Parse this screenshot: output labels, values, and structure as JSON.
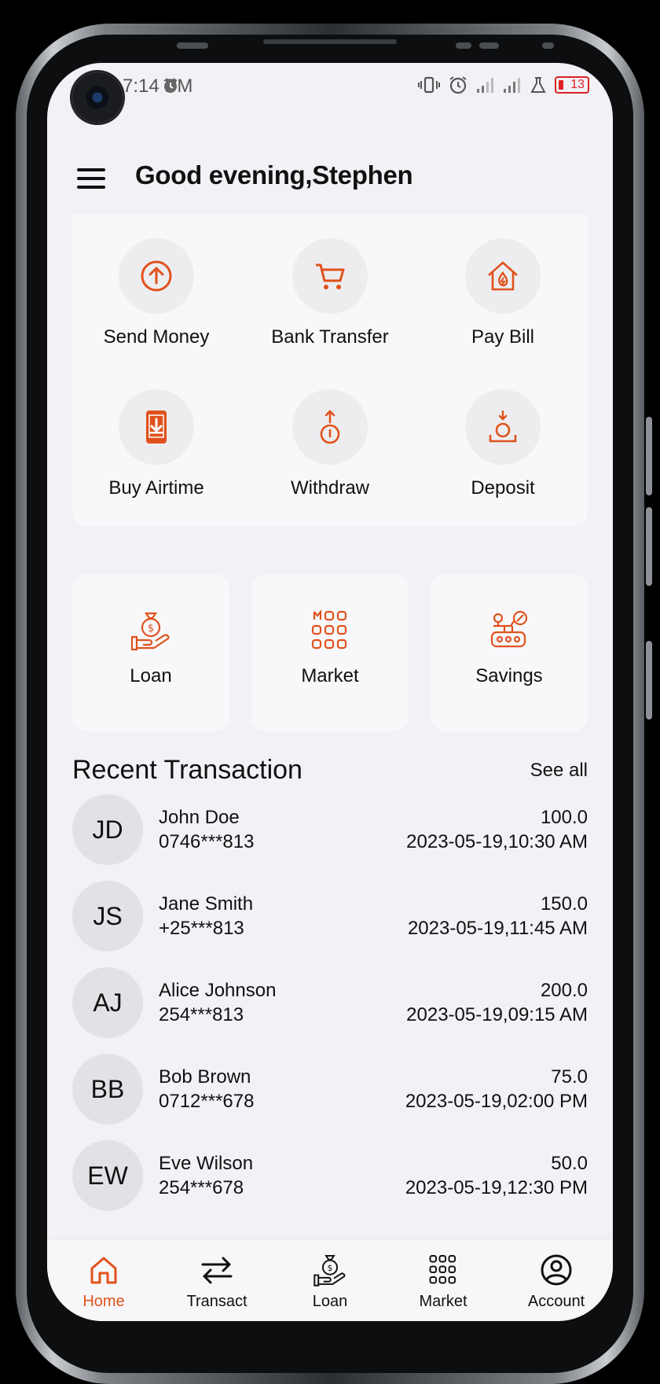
{
  "status_bar": {
    "time": "7:14 PM",
    "battery": "13"
  },
  "header": {
    "greeting": "Good evening,Stephen"
  },
  "quick_actions": [
    {
      "label": "Send Money",
      "icon": "arrow-up-circle-icon"
    },
    {
      "label": "Bank Transfer",
      "icon": "cart-icon"
    },
    {
      "label": "Pay Bill",
      "icon": "house-flame-icon"
    },
    {
      "label": "Buy Airtime",
      "icon": "phone-download-icon"
    },
    {
      "label": "Withdraw",
      "icon": "coin-arrow-up-icon"
    },
    {
      "label": "Deposit",
      "icon": "coin-arrow-down-icon"
    }
  ],
  "feature_tiles": [
    {
      "label": "Loan",
      "icon": "money-bag-hand-icon"
    },
    {
      "label": "Market",
      "icon": "grid-icon"
    },
    {
      "label": "Savings",
      "icon": "savings-icon"
    }
  ],
  "recent": {
    "title": "Recent Transaction",
    "see_all": "See all",
    "transactions": [
      {
        "initials": "JD",
        "name": "John Doe",
        "phone": "0746***813",
        "amount": "100.0",
        "date": "2023-05-19,10:30 AM"
      },
      {
        "initials": "JS",
        "name": "Jane Smith",
        "phone": "+25***813",
        "amount": "150.0",
        "date": "2023-05-19,11:45 AM"
      },
      {
        "initials": "AJ",
        "name": "Alice Johnson",
        "phone": "254***813",
        "amount": "200.0",
        "date": "2023-05-19,09:15 AM"
      },
      {
        "initials": "BB",
        "name": "Bob Brown",
        "phone": "0712***678",
        "amount": "75.0",
        "date": "2023-05-19,02:00 PM"
      },
      {
        "initials": "EW",
        "name": "Eve Wilson",
        "phone": "254***678",
        "amount": "50.0",
        "date": "2023-05-19,12:30 PM"
      }
    ]
  },
  "bottom_nav": [
    {
      "label": "Home",
      "active": true
    },
    {
      "label": "Transact",
      "active": false
    },
    {
      "label": "Loan",
      "active": false
    },
    {
      "label": "Market",
      "active": false
    },
    {
      "label": "Account",
      "active": false
    }
  ],
  "colors": {
    "accent": "#e0521c",
    "background": "#f1f1f6",
    "card": "#f8f8fa",
    "avatar_bg": "#e2e2e6"
  }
}
